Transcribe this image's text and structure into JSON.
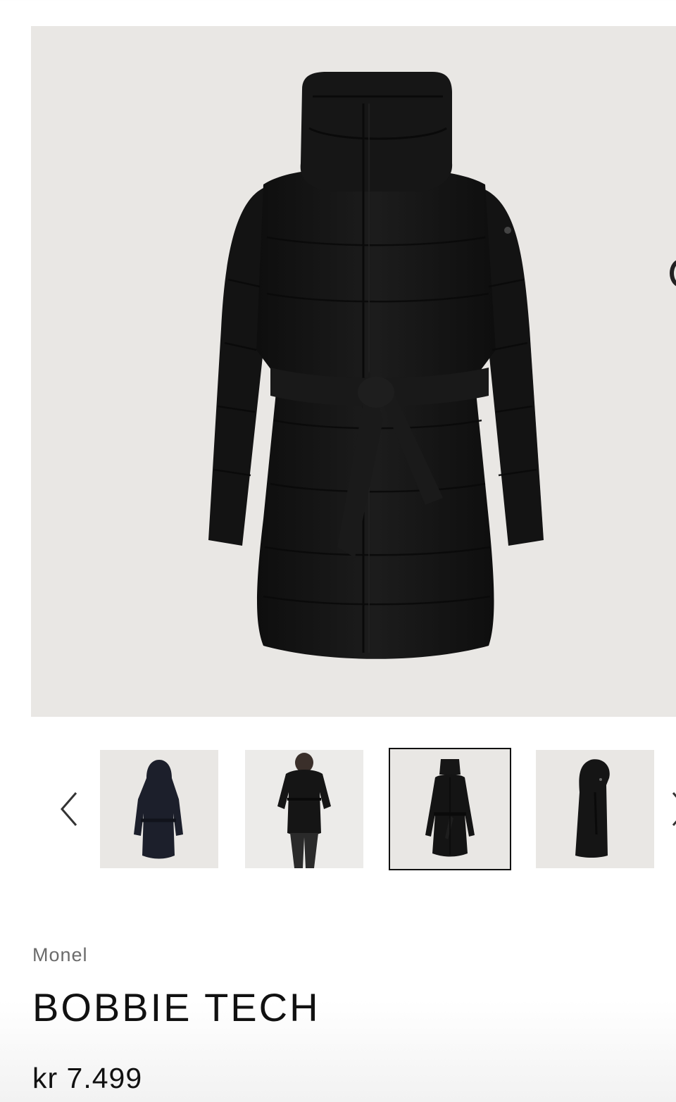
{
  "product": {
    "brand": "Monel",
    "name": "BOBBIE TECH",
    "price": "kr 7.499"
  },
  "gallery": {
    "main_image": "black belted puffer coat front view",
    "thumbnails": [
      {
        "name": "coat-back-view",
        "selected": false
      },
      {
        "name": "coat-worn-by-model",
        "selected": false
      },
      {
        "name": "coat-front-view",
        "selected": true
      },
      {
        "name": "coat-side-view",
        "selected": false
      }
    ],
    "icons": {
      "prev": "chevron-left-icon",
      "next": "chevron-right-icon"
    }
  },
  "colors": {
    "image_bg": "#e9e7e4",
    "coat": "#141414",
    "text": "#111111",
    "brand_text": "#6b6b6b"
  }
}
